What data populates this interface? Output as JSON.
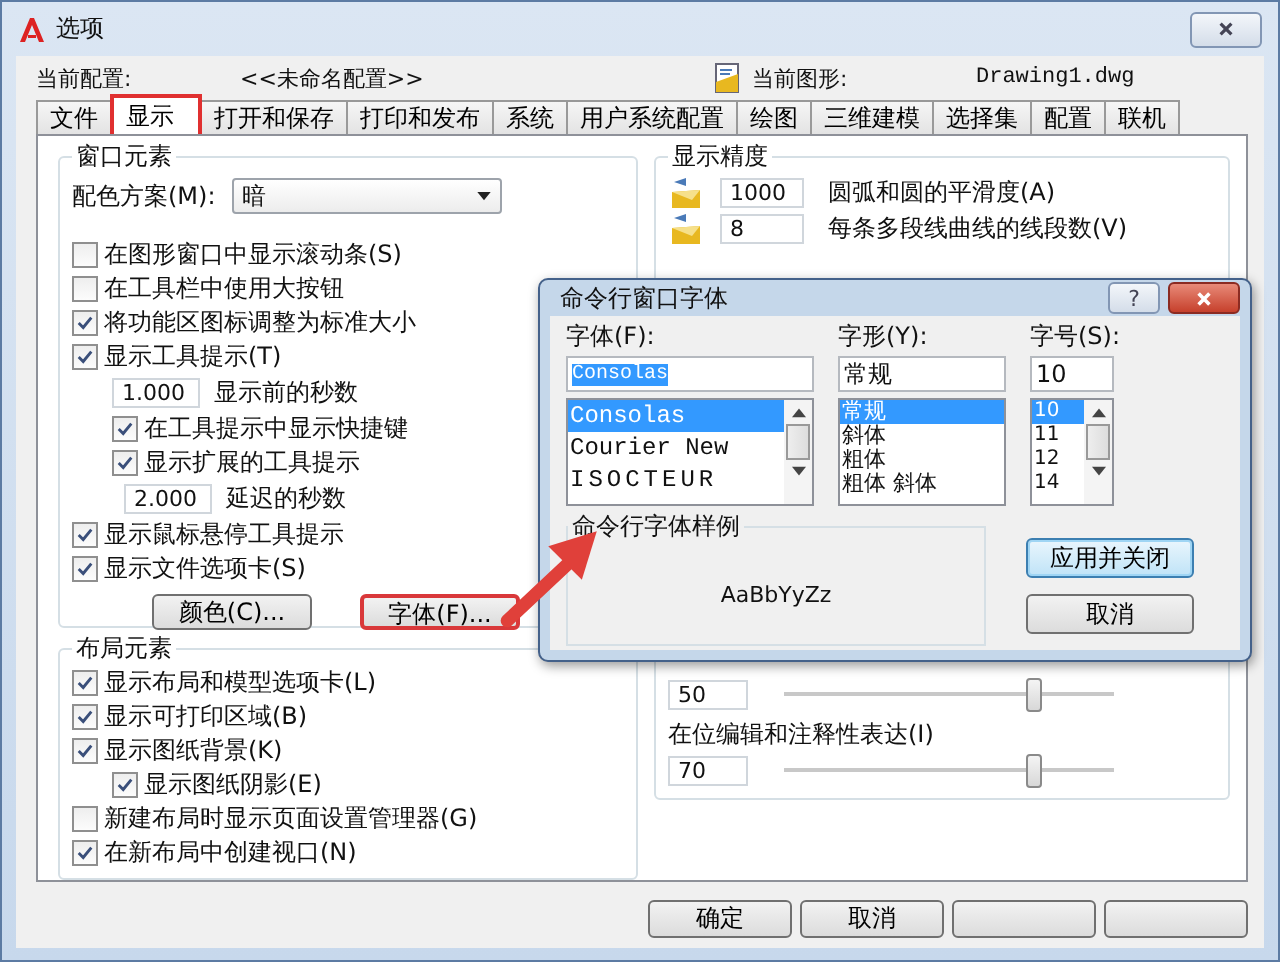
{
  "window": {
    "title": "选项"
  },
  "profile": {
    "label": "当前配置:",
    "value": "<<未命名配置>>"
  },
  "drawing": {
    "label": "当前图形:",
    "value": "Drawing1.dwg"
  },
  "tabs": [
    {
      "label": "文件",
      "selected": false
    },
    {
      "label": "显示",
      "selected": true
    },
    {
      "label": "打开和保存",
      "selected": false
    },
    {
      "label": "打印和发布",
      "selected": false
    },
    {
      "label": "系统",
      "selected": false
    },
    {
      "label": "用户系统配置",
      "selected": false
    },
    {
      "label": "绘图",
      "selected": false
    },
    {
      "label": "三维建模",
      "selected": false
    },
    {
      "label": "选择集",
      "selected": false
    },
    {
      "label": "配置",
      "selected": false
    },
    {
      "label": "联机",
      "selected": false
    }
  ],
  "window_elements": {
    "title": "窗口元素",
    "color_scheme": {
      "label": "配色方案(M):",
      "value": "暗"
    },
    "items": [
      {
        "kind": "checkbox",
        "label": "在图形窗口中显示滚动条(S)",
        "checked": false
      },
      {
        "kind": "checkbox",
        "label": "在工具栏中使用大按钮",
        "checked": false
      },
      {
        "kind": "checkbox",
        "label": "将功能区图标调整为标准大小",
        "checked": true
      },
      {
        "kind": "checkbox",
        "label": "显示工具提示(T)",
        "checked": true,
        "children": [
          {
            "kind": "number",
            "value": "1.000",
            "label": "显示前的秒数"
          },
          {
            "kind": "checkbox",
            "label": "在工具提示中显示快捷键",
            "checked": true
          },
          {
            "kind": "checkbox",
            "label": "显示扩展的工具提示",
            "checked": true,
            "children": [
              {
                "kind": "number",
                "value": "2.000",
                "label": "延迟的秒数"
              }
            ]
          }
        ]
      },
      {
        "kind": "checkbox",
        "label": "显示鼠标悬停工具提示",
        "checked": true
      },
      {
        "kind": "checkbox",
        "label": "显示文件选项卡(S)",
        "checked": true
      }
    ],
    "buttons": [
      {
        "label": "颜色(C)...",
        "highlighted": false
      },
      {
        "label": "字体(F)...",
        "highlighted": true
      }
    ]
  },
  "layout_elements": {
    "title": "布局元素",
    "items": [
      {
        "kind": "checkbox",
        "label": "显示布局和模型选项卡(L)",
        "checked": true
      },
      {
        "kind": "checkbox",
        "label": "显示可打印区域(B)",
        "checked": true
      },
      {
        "kind": "checkbox",
        "label": "显示图纸背景(K)",
        "checked": true,
        "children": [
          {
            "kind": "checkbox",
            "label": "显示图纸阴影(E)",
            "checked": true
          }
        ]
      },
      {
        "kind": "checkbox",
        "label": "新建布局时显示页面设置管理器(G)",
        "checked": false
      },
      {
        "kind": "checkbox",
        "label": "在新布局中创建视口(N)",
        "checked": true
      }
    ]
  },
  "display_precision": {
    "title": "显示精度",
    "rows": [
      {
        "value": "1000",
        "label": "圆弧和圆的平滑度(A)"
      },
      {
        "value": "8",
        "label": "每条多段线曲线的线段数(V)"
      }
    ]
  },
  "fade_controls": [
    {
      "value": "50",
      "level": 0.76
    },
    {
      "label": "在位编辑和注释性表达(I)",
      "value": "70",
      "level": 0.76
    }
  ],
  "buttons": [
    "确定",
    "取消"
  ],
  "font_dialog": {
    "title": "命令行窗口字体",
    "help": "?",
    "font": {
      "label": "字体(F):",
      "value": "Consolas",
      "options": [
        {
          "label": "Consolas",
          "selected": true
        },
        {
          "label": "Courier New",
          "selected": false
        },
        {
          "label": "ISOCTEUR",
          "selected": false
        }
      ]
    },
    "style": {
      "label": "字形(Y):",
      "value": "常规",
      "options": [
        {
          "label": "常规",
          "selected": true
        },
        {
          "label": "斜体",
          "selected": false
        },
        {
          "label": "粗体",
          "selected": false
        },
        {
          "label": "粗体 斜体",
          "selected": false
        }
      ]
    },
    "size": {
      "label": "字号(S):",
      "value": "10",
      "options": [
        {
          "label": "10",
          "selected": true
        },
        {
          "label": "11",
          "selected": false
        },
        {
          "label": "12",
          "selected": false
        },
        {
          "label": "14",
          "selected": false
        }
      ]
    },
    "sample": {
      "title": "命令行字体样例",
      "text": "AaBbYyZz"
    },
    "buttons": [
      {
        "label": "应用并关闭",
        "default": true
      },
      {
        "label": "取消",
        "default": false
      }
    ]
  }
}
